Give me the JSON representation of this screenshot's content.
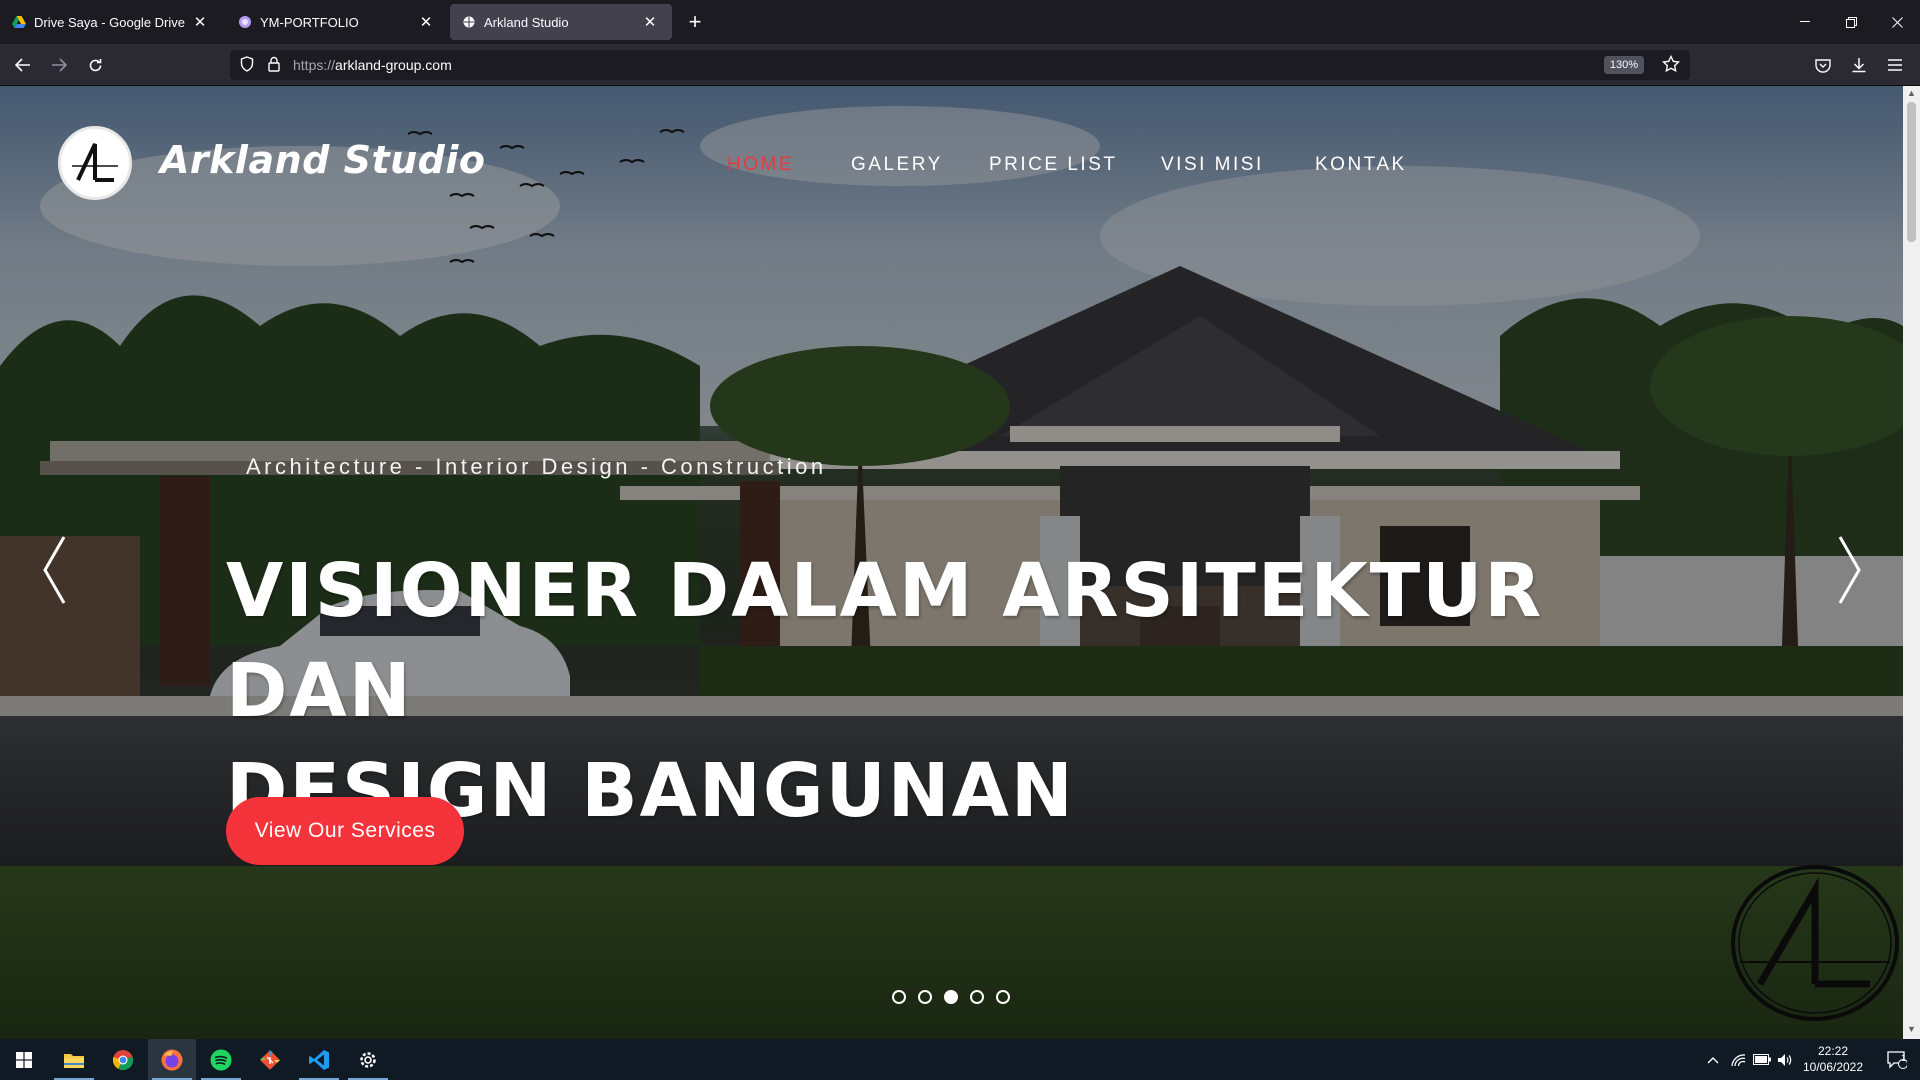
{
  "browser": {
    "tabs": [
      {
        "title": "Drive Saya - Google Drive",
        "active": false
      },
      {
        "title": "YM-PORTFOLIO",
        "active": false
      },
      {
        "title": "Arkland Studio",
        "active": true
      }
    ],
    "url_protocol": "https://",
    "url_host": "arkland-group.com",
    "zoom": "130%"
  },
  "site": {
    "brand": "Arkland Studio",
    "menu": [
      "HOME",
      "GALERY",
      "PRICE LIST",
      "VISI MISI",
      "KONTAK"
    ],
    "active_menu": "HOME"
  },
  "hero": {
    "tagline": "Architecture - Interior Design - Construction",
    "headline_line1": "VISIONER DALAM ARSITEKTUR DAN",
    "headline_line2": "DESIGN BANGUNAN",
    "cta": "View Our Services",
    "slides_count": 5,
    "active_slide": 3
  },
  "taskbar": {
    "apps": [
      "windows-start",
      "file-explorer",
      "chrome",
      "firefox",
      "spotify",
      "git",
      "vscode",
      "settings"
    ],
    "time": "22:22",
    "date": "10/06/2022",
    "notifications": "1"
  },
  "colors": {
    "accent": "#f4333a",
    "active_menu": "#e8393e"
  }
}
